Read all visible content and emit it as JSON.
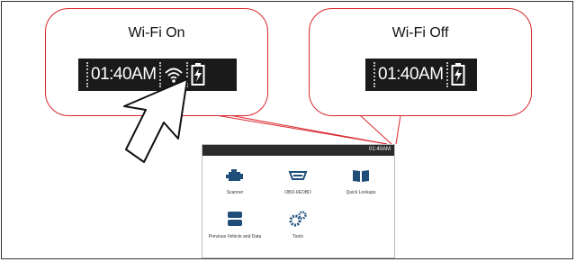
{
  "callouts": {
    "wifi_on": {
      "title": "Wi-Fi On",
      "time": "01:40AM"
    },
    "wifi_off": {
      "title": "Wi-Fi Off",
      "time": "01:40AM"
    }
  },
  "device": {
    "statusbar_time": "01:40AM",
    "apps": [
      {
        "label": "Scanner"
      },
      {
        "label": "OBD-I/EOBD"
      },
      {
        "label": "Quick Lookups"
      },
      {
        "label": "Previous Vehicle and Data"
      },
      {
        "label": "Tools"
      }
    ]
  },
  "colors": {
    "callout_border": "#d8262c",
    "statusbar": "#1a1a1a"
  }
}
